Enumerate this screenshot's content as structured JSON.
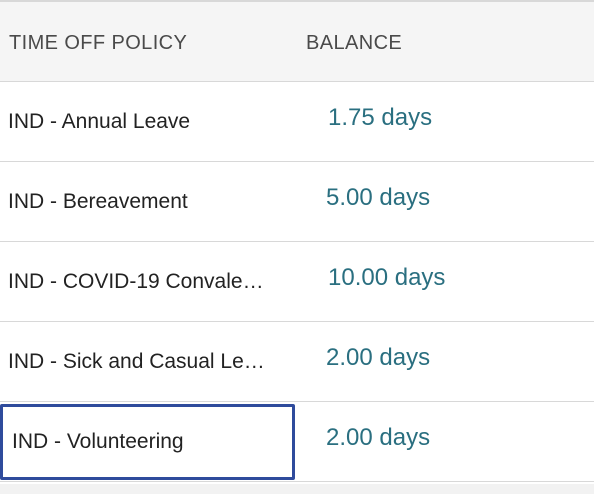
{
  "table": {
    "columns": {
      "policy": "TIME OFF POLICY",
      "balance": "BALANCE"
    },
    "rows": [
      {
        "policy": "IND - Annual Leave",
        "balance": "1.75 days"
      },
      {
        "policy": "IND - Bereavement",
        "balance": "5.00 days"
      },
      {
        "policy": "IND - COVID-19 Convale…",
        "balance": "10.00 days"
      },
      {
        "policy": "IND - Sick and Casual Le…",
        "balance": "2.00 days"
      },
      {
        "policy": "IND - Volunteering",
        "balance": "2.00 days",
        "focused": true
      }
    ]
  },
  "colors": {
    "header_bg": "#f5f5f5",
    "balance_text": "#2a6f80",
    "focus_ring": "#2f4b9c",
    "divider": "#d8d8d8"
  }
}
